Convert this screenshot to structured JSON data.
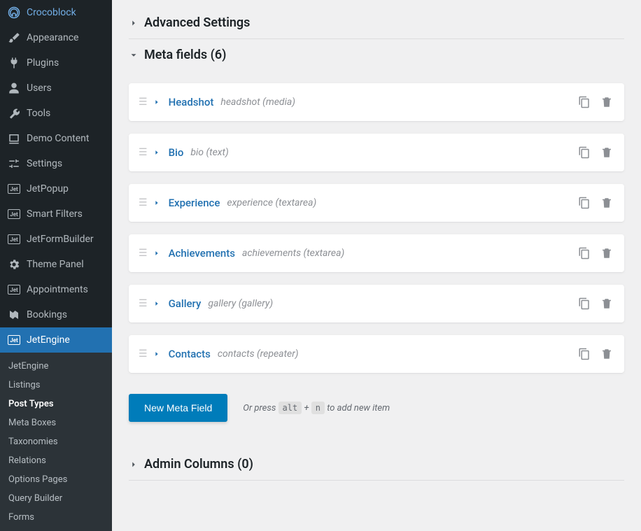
{
  "sidebar": {
    "items": [
      {
        "label": "Crocoblock",
        "icon": "croco"
      },
      {
        "label": "Appearance",
        "icon": "brush"
      },
      {
        "label": "Plugins",
        "icon": "plug"
      },
      {
        "label": "Users",
        "icon": "user"
      },
      {
        "label": "Tools",
        "icon": "wrench"
      },
      {
        "label": "Demo Content",
        "icon": "demo"
      },
      {
        "label": "Settings",
        "icon": "sliders"
      },
      {
        "label": "JetPopup",
        "icon": "box",
        "box": "Jet"
      },
      {
        "label": "Smart Filters",
        "icon": "box",
        "box": "Jet"
      },
      {
        "label": "JetFormBuilder",
        "icon": "box",
        "box": "Jet"
      },
      {
        "label": "Theme Panel",
        "icon": "gear"
      },
      {
        "label": "Appointments",
        "icon": "box",
        "box": "Jet"
      },
      {
        "label": "Bookings",
        "icon": "bookings"
      },
      {
        "label": "JetEngine",
        "icon": "box",
        "box": "Jet",
        "active": true
      }
    ],
    "submenu": [
      {
        "label": "JetEngine"
      },
      {
        "label": "Listings"
      },
      {
        "label": "Post Types",
        "selected": true
      },
      {
        "label": "Meta Boxes"
      },
      {
        "label": "Taxonomies"
      },
      {
        "label": "Relations"
      },
      {
        "label": "Options Pages"
      },
      {
        "label": "Query Builder"
      },
      {
        "label": "Forms"
      }
    ]
  },
  "sections": {
    "advanced": {
      "title": "Advanced Settings",
      "expanded": false
    },
    "meta": {
      "title": "Meta fields (6)",
      "expanded": true
    },
    "admin_columns": {
      "title": "Admin Columns (0)",
      "expanded": false
    }
  },
  "meta_fields": [
    {
      "name": "Headshot",
      "slug": "headshot (media)"
    },
    {
      "name": "Bio",
      "slug": "bio (text)"
    },
    {
      "name": "Experience",
      "slug": "experience (textarea)"
    },
    {
      "name": "Achievements",
      "slug": "achievements (textarea)"
    },
    {
      "name": "Gallery",
      "slug": "gallery (gallery)"
    },
    {
      "name": "Contacts",
      "slug": "contacts (repeater)"
    }
  ],
  "new_field": {
    "button": "New Meta Field",
    "hint_pre": "Or press ",
    "key_alt": "alt",
    "plus": " + ",
    "key_n": "n",
    "hint_post": " to add new item"
  }
}
